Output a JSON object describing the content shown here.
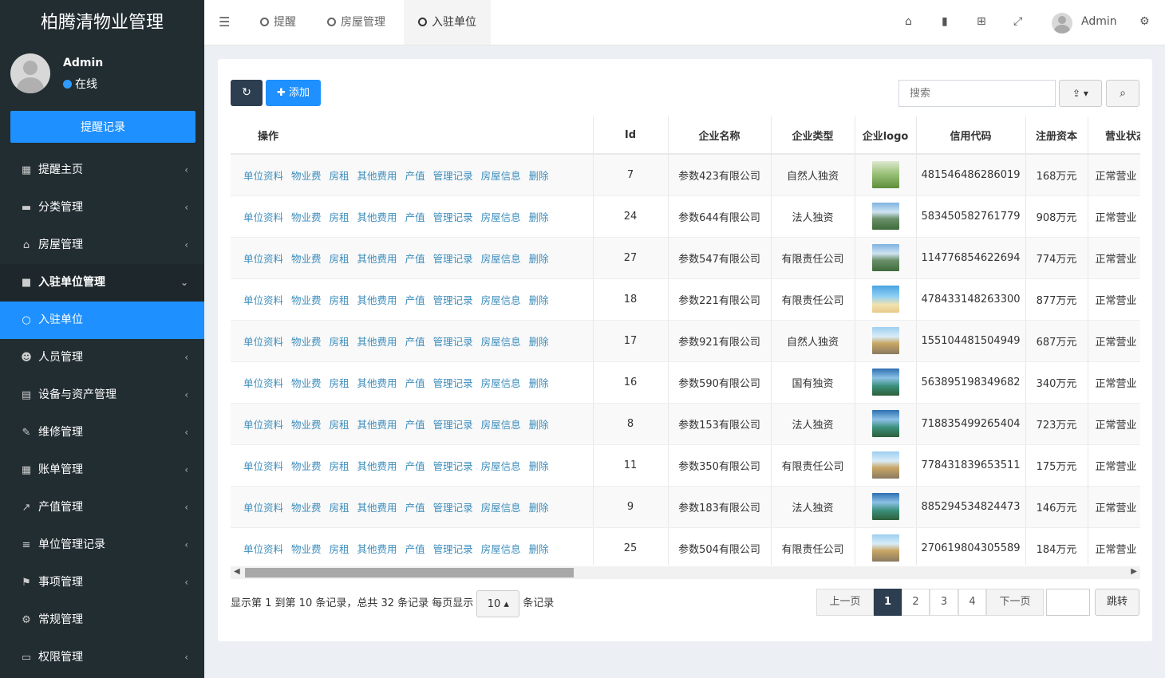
{
  "app": {
    "title": "柏腾清物业管理"
  },
  "user": {
    "name": "Admin",
    "status": "在线"
  },
  "sidebar": {
    "remind_button": "提醒记录",
    "items": [
      {
        "label": "提醒主页",
        "icon": "calendar-icon",
        "glyph": "▦"
      },
      {
        "label": "分类管理",
        "icon": "book-icon",
        "glyph": "▬"
      },
      {
        "label": "房屋管理",
        "icon": "home-icon",
        "glyph": "⌂"
      },
      {
        "label": "入驻单位管理",
        "icon": "briefcase-icon",
        "glyph": "■"
      },
      {
        "label": "入驻单位",
        "icon": "circle-icon",
        "glyph": "○"
      },
      {
        "label": "人员管理",
        "icon": "users-icon",
        "glyph": "☻"
      },
      {
        "label": "设备与资产管理",
        "icon": "list-alt-icon",
        "glyph": "▤"
      },
      {
        "label": "维修管理",
        "icon": "wrench-icon",
        "glyph": "✎"
      },
      {
        "label": "账单管理",
        "icon": "calculator-icon",
        "glyph": "▦"
      },
      {
        "label": "产值管理",
        "icon": "line-chart-icon",
        "glyph": "↗"
      },
      {
        "label": "单位管理记录",
        "icon": "bars-icon",
        "glyph": "≡"
      },
      {
        "label": "事项管理",
        "icon": "flag-icon",
        "glyph": "⚑"
      },
      {
        "label": "常规管理",
        "icon": "cogs-icon",
        "glyph": "⚙"
      },
      {
        "label": "权限管理",
        "icon": "desktop-icon",
        "glyph": "▭"
      }
    ]
  },
  "topbar": {
    "tabs": [
      "提醒",
      "房屋管理",
      "入驻单位"
    ],
    "admin": "Admin"
  },
  "toolbar": {
    "add_label": "✚ 添加",
    "search_placeholder": "搜索"
  },
  "table": {
    "headers": [
      "操作",
      "Id",
      "企业名称",
      "企业类型",
      "企业logo",
      "信用代码",
      "注册资本",
      "营业状态"
    ],
    "actions": [
      "单位资料",
      "物业费",
      "房租",
      "其他费用",
      "产值",
      "管理记录",
      "房屋信息",
      "删除"
    ],
    "rows": [
      {
        "id": "7",
        "name": "参数423有限公司",
        "type": "自然人独资",
        "logo": "tree",
        "code": "481546486286019",
        "capital": "168万元",
        "status": "正常营业"
      },
      {
        "id": "24",
        "name": "参数644有限公司",
        "type": "法人独资",
        "logo": "mountain",
        "code": "583450582761779",
        "capital": "908万元",
        "status": "正常营业"
      },
      {
        "id": "27",
        "name": "参数547有限公司",
        "type": "有限责任公司",
        "logo": "mountain",
        "code": "114776854622694",
        "capital": "774万元",
        "status": "正常营业"
      },
      {
        "id": "18",
        "name": "参数221有限公司",
        "type": "有限责任公司",
        "logo": "beach",
        "code": "478433148263300",
        "capital": "877万元",
        "status": "正常营业"
      },
      {
        "id": "17",
        "name": "参数921有限公司",
        "type": "自然人独资",
        "logo": "road",
        "code": "155104481504949",
        "capital": "687万元",
        "status": "正常营业"
      },
      {
        "id": "16",
        "name": "参数590有限公司",
        "type": "国有独资",
        "logo": "lake",
        "code": "563895198349682",
        "capital": "340万元",
        "status": "正常营业"
      },
      {
        "id": "8",
        "name": "参数153有限公司",
        "type": "法人独资",
        "logo": "lake",
        "code": "718835499265404",
        "capital": "723万元",
        "status": "正常营业"
      },
      {
        "id": "11",
        "name": "参数350有限公司",
        "type": "有限责任公司",
        "logo": "road",
        "code": "778431839653511",
        "capital": "175万元",
        "status": "正常营业"
      },
      {
        "id": "9",
        "name": "参数183有限公司",
        "type": "法人独资",
        "logo": "lake",
        "code": "885294534824473",
        "capital": "146万元",
        "status": "正常营业"
      },
      {
        "id": "25",
        "name": "参数504有限公司",
        "type": "有限责任公司",
        "logo": "road",
        "code": "270619804305589",
        "capital": "184万元",
        "status": "正常营业"
      }
    ]
  },
  "pagination": {
    "info_prefix": "显示第 1 到第 10 条记录，总共 32 条记录 每页显示",
    "page_size": "10 ▴",
    "info_suffix": "条记录",
    "prev": "上一页",
    "pages": [
      "1",
      "2",
      "3",
      "4"
    ],
    "next": "下一页",
    "jump": "跳转"
  },
  "colors": {
    "sidebar_bg": "#222d32",
    "accent": "#1e90ff",
    "link": "#3c8dbc",
    "dark_btn": "#2c3e50"
  }
}
